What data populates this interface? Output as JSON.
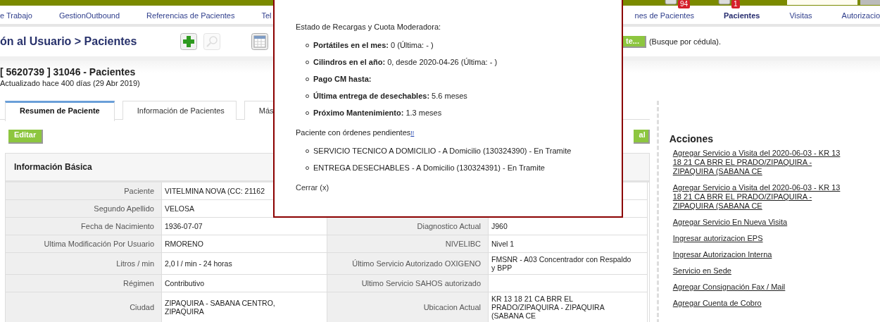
{
  "top_bar": {
    "notifications": [
      {
        "count": "94"
      },
      {
        "count": "1"
      }
    ]
  },
  "nav": [
    {
      "label": "e Trabajo",
      "selected": false
    },
    {
      "label": "GestionOutbound",
      "selected": false
    },
    {
      "label": "Referencias de Pacientes",
      "selected": false
    },
    {
      "label": "Tel",
      "selected": false
    },
    {
      "label": "nes de Pacientes",
      "selected": false
    },
    {
      "label": "Pacientes",
      "selected": true
    },
    {
      "label": "Visitas",
      "selected": false
    },
    {
      "label": "Autorizacio",
      "selected": false
    }
  ],
  "page_title": "ón al Usuario > Pacientes",
  "search_button": "te...",
  "search_hint": "(Busque por cédula).",
  "patient": {
    "title": "[ 5620739 ] 31046 - Pacientes",
    "updated": "Actualizado hace 400 días (29 Abr 2019)"
  },
  "tabs": [
    {
      "label": "Resumen de Paciente",
      "selected": true
    },
    {
      "label": "Información de Pacientes",
      "selected": false
    },
    {
      "label": "Más",
      "selected": false
    }
  ],
  "edit_button": "Editar",
  "right_button": "al",
  "basic_info": {
    "title": "Información Básica",
    "rows": [
      {
        "left": {
          "label": "Paciente",
          "value": "VITELMINA NOVA (CC: 21162"
        }
      },
      {
        "left": {
          "label": "Segundo Apellido",
          "value": "VELOSA"
        }
      },
      {
        "left": {
          "label": "Fecha de Nacimiento",
          "value": "1936-07-07"
        },
        "right": {
          "label": "Diagnostico Actual",
          "value": "J960"
        }
      },
      {
        "left": {
          "label": "Ultima Modificación Por Usuario",
          "value": "RMORENO"
        },
        "right": {
          "label": "NIVELIBC",
          "value": "Nivel 1"
        }
      },
      {
        "left": {
          "label": "Litros / min",
          "value": "2,0 l / min - 24 horas"
        },
        "right": {
          "label": "Último Servicio Autorizado OXIGENO",
          "value": "FMSNR - A03 Concentrador con Respaldo y BPP"
        }
      },
      {
        "left": {
          "label": "Régimen",
          "value": "Contributivo"
        },
        "right": {
          "label": "Ultimo Servicio SAHOS autorizado"
        }
      },
      {
        "left": {
          "label": "Ciudad",
          "value": "ZIPAQUIRA - SABANA CENTRO, ZIPAQUIRA"
        },
        "right": {
          "label": "Ubicacion Actual",
          "value": "KR 13 18 21 CA BRR EL PRADO/ZIPAQUIRA - ZIPAQUIRA (SABANA CE"
        }
      }
    ]
  },
  "actions": {
    "title": "Acciones",
    "links": [
      "Agregar Servicio a Visita del 2020-06-03 - KR 13 18 21 CA BRR EL PRADO/ZIPAQUIRA - ZIPAQUIRA (SABANA CE",
      "Agregar Servicio a Visita del 2020-06-03 - KR 13 18 21 CA BRR EL PRADO/ZIPAQUIRA - ZIPAQUIRA (SABANA CE",
      "Agregar Servicio En Nueva Visita",
      "Ingresar autorizacion EPS",
      "Ingresar Autorizacion Interna",
      "Servicio en Sede",
      "Agregar Consignación Fax / Mail",
      "Agregar Cuenta de Cobro"
    ]
  },
  "modal": {
    "heading": "Estado de Recargas y Cuota Moderadora:",
    "stats": [
      {
        "label": "Portátiles en el mes:",
        "value": "0 (Última: - )"
      },
      {
        "label": "Cilindros en el año:",
        "value": "0, desde 2020-04-26 (Última: - )"
      },
      {
        "label": "Pago CM hasta:"
      },
      {
        "label": "Última entrega de desechables:",
        "value": "5.6 meses"
      },
      {
        "label": "Próximo Mantenimiento:",
        "value": "1.3 meses"
      }
    ],
    "pending": "Paciente con órdenes pendientes",
    "pending_link": "!!",
    "orders": [
      "SERVICIO TECNICO A DOMICILIO - A Domicilio (130324390) - En Tramite",
      "ENTREGA DESECHABLES - A Domicilio (130324391) - En Tramite"
    ],
    "close": "Cerrar (x)"
  }
}
